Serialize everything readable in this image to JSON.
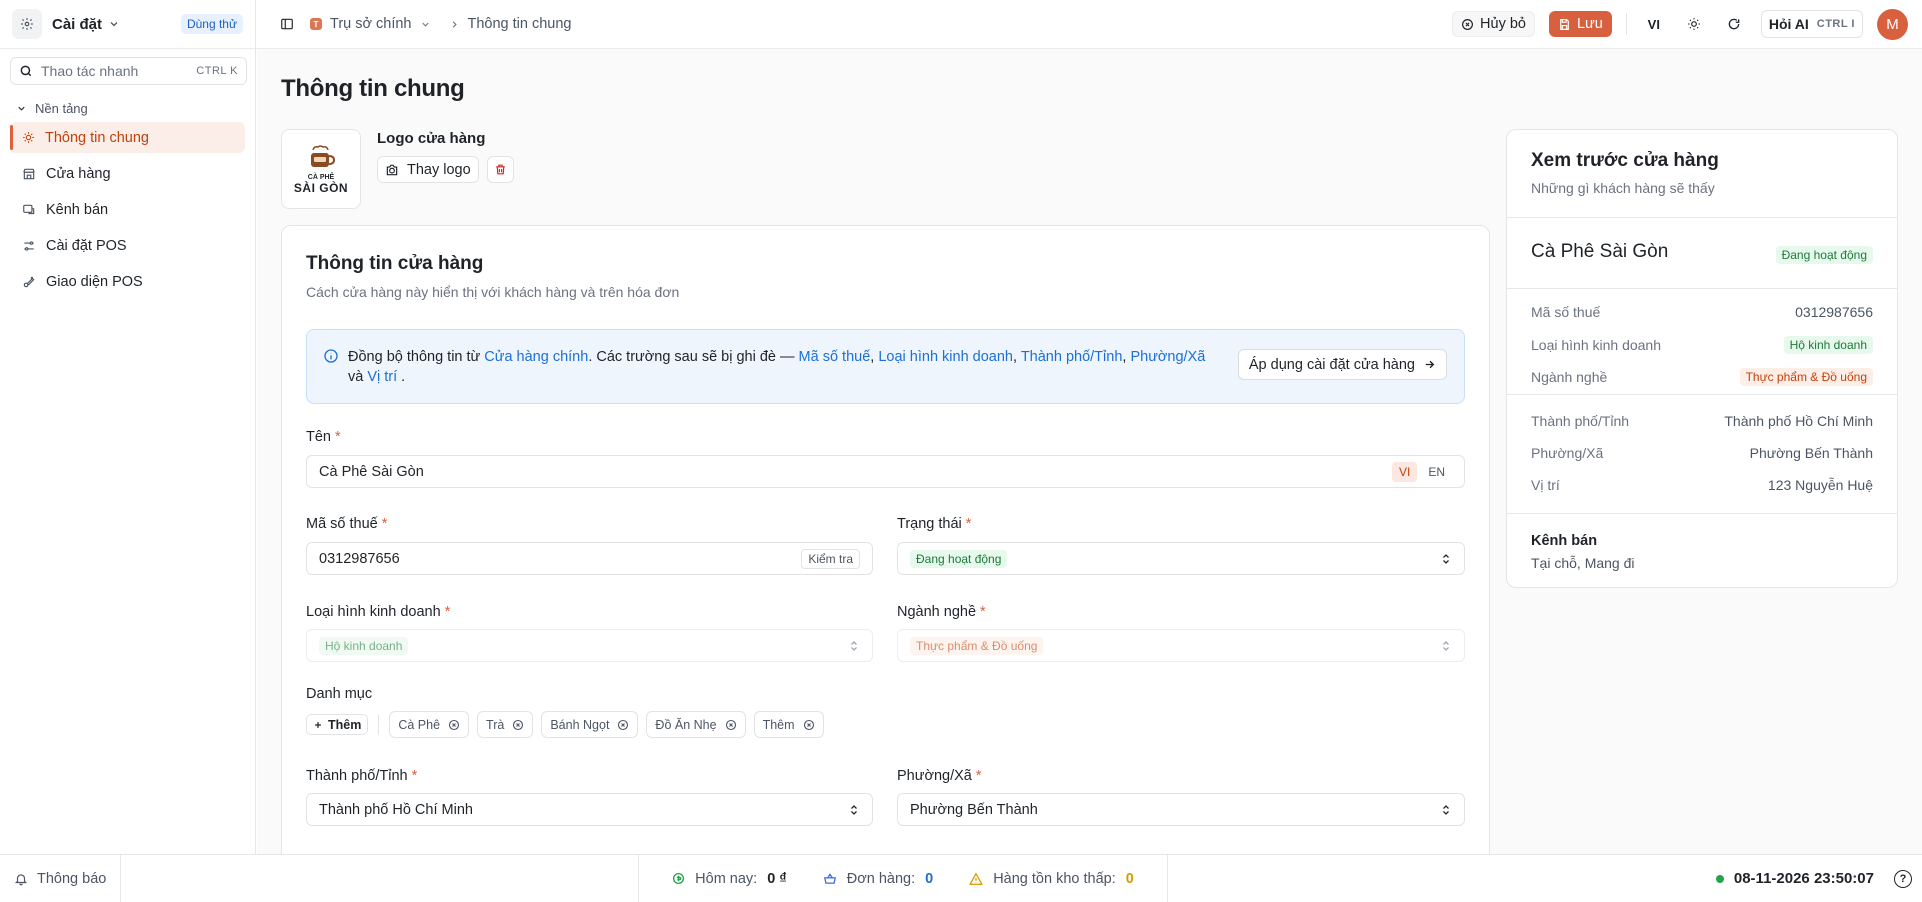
{
  "app": {
    "settings_label": "Cài đặt",
    "trial_badge": "Dùng thử"
  },
  "sidebar": {
    "search": {
      "placeholder": "Thao tác nhanh",
      "shortcut": "CTRL K"
    },
    "group_label": "Nền tảng",
    "items": [
      {
        "label": "Thông tin chung",
        "icon": "sun-gear-icon",
        "active": true
      },
      {
        "label": "Cửa hàng",
        "icon": "store-icon"
      },
      {
        "label": "Kênh bán",
        "icon": "channel-icon"
      },
      {
        "label": "Cài đặt POS",
        "icon": "sliders-icon"
      },
      {
        "label": "Giao diện POS",
        "icon": "palette-icon"
      }
    ]
  },
  "topbar": {
    "breadcrumb": [
      "Trụ sở chính",
      "Thông tin chung"
    ],
    "breadcrumb_dot": "T",
    "cancel_label": "Hủy bỏ",
    "save_label": "Lưu",
    "lang": "VI",
    "ai_label": "Hỏi AI",
    "ai_shortcut": "CTRL I",
    "avatar_letter": "M"
  },
  "page": {
    "title": "Thông tin chung",
    "logo": {
      "section_label": "Logo cửa hàng",
      "change_label": "Thay logo",
      "brand_top": "CÀ PHÊ",
      "brand_bottom": "SÀI GÒN"
    }
  },
  "form": {
    "title": "Thông tin cửa hàng",
    "subtitle": "Cách cửa hàng này hiển thị với khách hàng và trên hóa đơn",
    "sync_notice": {
      "t1": "Đồng bộ thông tin từ ",
      "link_main": "Cửa hàng chính",
      "t2": ". Các trường sau sẽ bị ghi đè — ",
      "f1": "Mã số thuế",
      "f2": "Loại hình kinh doanh",
      "f3": "Thành phố/Tỉnh",
      "f4": "Phường/Xã",
      "and": "và ",
      "f5": "Vị trí",
      "end": " .",
      "apply_label": "Áp dụng cài đặt cửa hàng"
    },
    "name": {
      "label": "Tên",
      "value": "Cà Phê Sài Gòn",
      "lang_vi": "VI",
      "lang_en": "EN"
    },
    "tax": {
      "label": "Mã số thuế",
      "value": "0312987656",
      "check_label": "Kiểm tra"
    },
    "status": {
      "label": "Trạng thái",
      "value": "Đang hoạt động"
    },
    "business_type": {
      "label": "Loại hình kinh doanh",
      "value": "Hộ kinh doanh"
    },
    "industry": {
      "label": "Ngành nghề",
      "value": "Thực phẩm & Đồ uống"
    },
    "categories": {
      "label": "Danh mục",
      "add_label": "Thêm",
      "items": [
        "Cà Phê",
        "Trà",
        "Bánh Ngọt",
        "Đồ Ăn Nhẹ",
        "Thêm"
      ]
    },
    "city": {
      "label": "Thành phố/Tỉnh",
      "value": "Thành phố Hồ Chí Minh"
    },
    "ward": {
      "label": "Phường/Xã",
      "value": "Phường Bến Thành"
    },
    "required_mark": "*"
  },
  "preview": {
    "title": "Xem trước cửa hàng",
    "subtitle": "Những gì khách hàng sẽ thấy",
    "store_name": "Cà Phê Sài Gòn",
    "status": "Đang hoạt động",
    "rows": [
      {
        "k": "Mã số thuế",
        "v": "0312987656"
      },
      {
        "k": "Loại hình kinh doanh",
        "v": "Hộ kinh doanh"
      },
      {
        "k": "Ngành nghề",
        "v": "Thực phẩm & Đồ uống"
      },
      {
        "k": "Thành phố/Tỉnh",
        "v": "Thành phố Hồ Chí Minh"
      },
      {
        "k": "Phường/Xã",
        "v": "Phường Bến Thành"
      },
      {
        "k": "Vị trí",
        "v": "123 Nguyễn Huệ"
      }
    ],
    "channels_label": "Kênh bán",
    "channels_value": "Tại chỗ, Mang đi"
  },
  "bottombar": {
    "notify_label": "Thông báo",
    "today_label": "Hôm nay:",
    "today_value": "0 ₫",
    "orders_label": "Đơn hàng:",
    "orders_value": "0",
    "low_stock_label": "Hàng tồn kho thấp:",
    "low_stock_value": "0",
    "datetime": "08-11-2026 23:50:07",
    "help": "?"
  },
  "colors": {
    "accent": "#d9603f",
    "link": "#1d6fd6",
    "success": "#22a34a",
    "warning": "#d79b00"
  }
}
